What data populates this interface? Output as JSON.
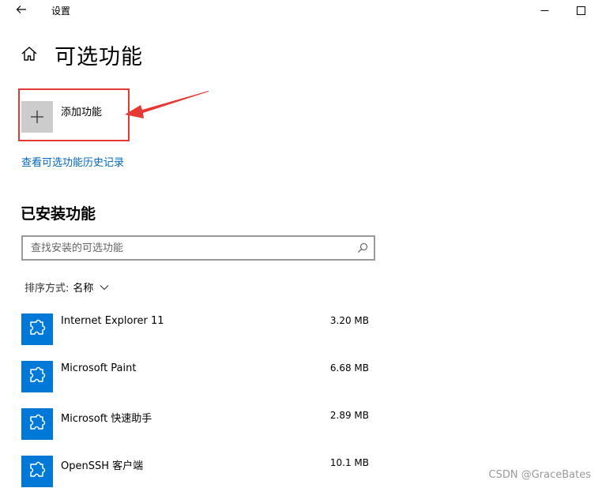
{
  "window": {
    "title": "设置",
    "back_label": "←"
  },
  "page": {
    "title": "可选功能"
  },
  "add_feature": {
    "label": "添加功能"
  },
  "history_link": {
    "label": "查看可选功能历史记录"
  },
  "installed": {
    "title": "已安装功能",
    "search_placeholder": "查找安装的可选功能",
    "sort_label": "排序方式:",
    "sort_value": "名称",
    "items": [
      {
        "name": "Internet Explorer 11",
        "size": "3.20 MB"
      },
      {
        "name": "Microsoft Paint",
        "size": "6.68 MB"
      },
      {
        "name": "Microsoft 快速助手",
        "size": "2.89 MB"
      },
      {
        "name": "OpenSSH 客户端",
        "size": "10.1 MB"
      }
    ]
  },
  "watermark": "CSDN @GraceBates",
  "colors": {
    "accent": "#0078d7",
    "link": "#0067c0",
    "highlight": "#e53935",
    "tile": "#cccccc"
  }
}
